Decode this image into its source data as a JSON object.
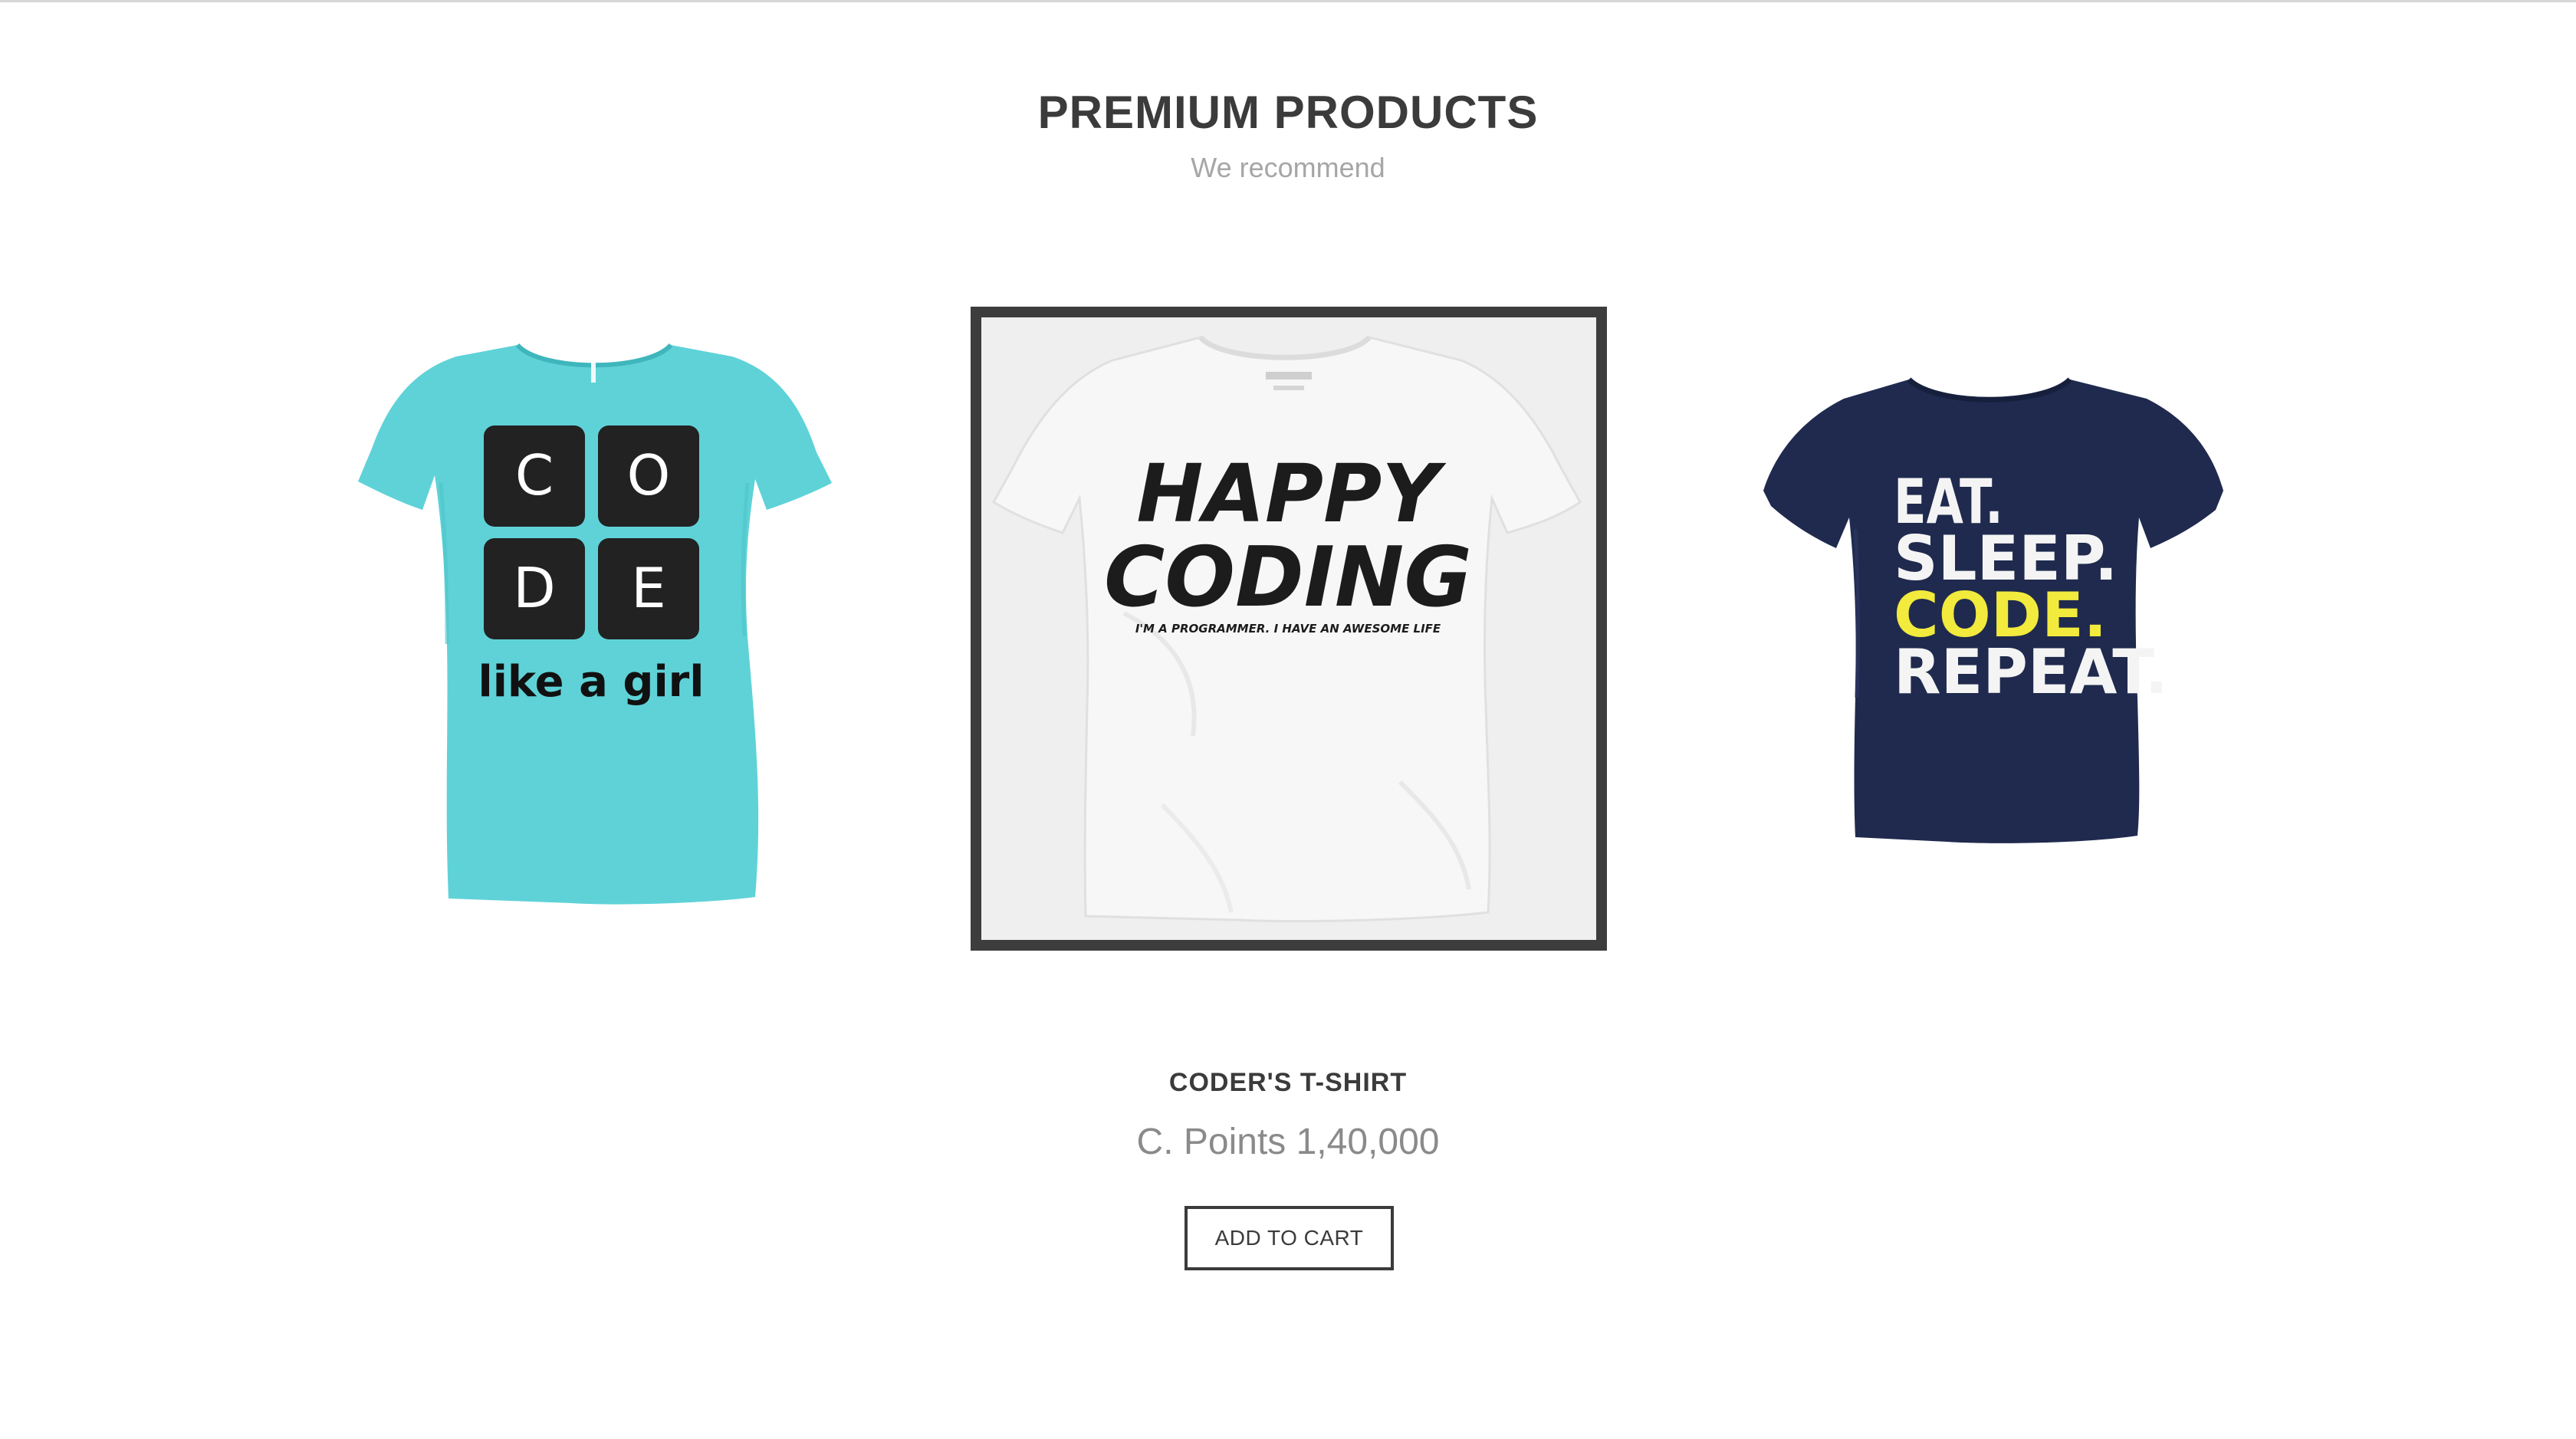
{
  "section": {
    "title": "PREMIUM PRODUCTS",
    "subtitle": "We recommend"
  },
  "products": [
    {
      "id": "left",
      "shirt_color": "#5fd2d8",
      "print_text": {
        "letters": [
          "C",
          "O",
          "D",
          "E"
        ],
        "tagline": "like a girl"
      }
    },
    {
      "id": "center",
      "shirt_color": "#f7f7f7",
      "selected": true,
      "print_text": {
        "line1": "HAPPY",
        "line2": "CODING",
        "tagline": "I'M A PROGRAMMER. I HAVE AN AWESOME LIFE"
      }
    },
    {
      "id": "right",
      "shirt_color": "#1f2a4e",
      "print_text": {
        "line1": "EAT.",
        "line2": "SLEEP.",
        "line3": "CODE.",
        "line4": "REPEAT."
      },
      "accent_color": "#f2ea3c"
    }
  ],
  "selected_product": {
    "name": "CODER'S T-SHIRT",
    "price": "C. Points 1,40,000",
    "add_to_cart_label": "ADD TO CART"
  },
  "colors": {
    "frame": "#3d3d3d",
    "title": "#3b3b3b",
    "subtitle": "#a6a6a6",
    "price": "#8a8a8a"
  }
}
